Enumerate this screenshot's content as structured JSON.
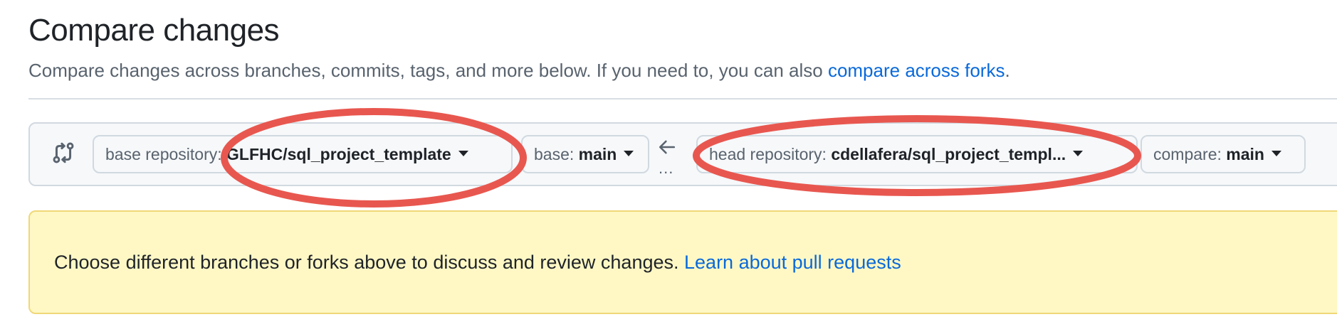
{
  "header": {
    "title": "Compare changes",
    "subtitle_prefix": "Compare changes across branches, commits, tags, and more below. If you need to, you can also",
    "subtitle_link": "compare across forks",
    "subtitle_suffix": "."
  },
  "range": {
    "icon": "git-compare-icon",
    "base_repository": {
      "prefix": "base repository:",
      "value": "GLFHC/sql_project_template"
    },
    "base_branch": {
      "prefix": "base:",
      "value": "main"
    },
    "direction_icon": "arrow-left-icon",
    "dots": "...",
    "head_repository": {
      "prefix": "head repository:",
      "value": "cdellafera/sql_project_templ..."
    },
    "compare_branch": {
      "prefix": "compare:",
      "value": "main"
    }
  },
  "flash": {
    "message": "Choose different branches or forks above to discuss and review changes.",
    "link": "Learn about pull requests"
  },
  "annotations": {
    "color": "#e8574f",
    "count": 2
  }
}
